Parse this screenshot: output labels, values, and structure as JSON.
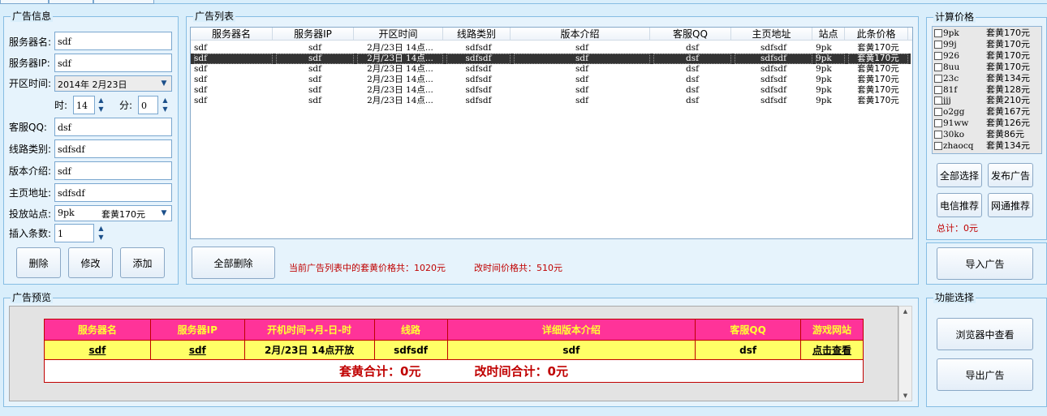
{
  "left_panel": {
    "title": "广告信息",
    "fields": {
      "server_name": {
        "label": "服务器名:",
        "value": "sdf"
      },
      "server_ip": {
        "label": "服务器IP:",
        "value": "sdf"
      },
      "open_time": {
        "label": "开区时间:",
        "value": "2014年 2月23日"
      },
      "hour": {
        "label": "时:",
        "value": "14"
      },
      "minute": {
        "label": "分:",
        "value": "0"
      },
      "qq": {
        "label": "客服QQ:",
        "value": "dsf"
      },
      "line_type": {
        "label": "线路类别:",
        "value": "sdfsdf"
      },
      "version": {
        "label": "版本介绍:",
        "value": "sdf"
      },
      "homepage": {
        "label": "主页地址:",
        "value": "sdfsdf"
      },
      "site": {
        "label": "投放站点:",
        "value_name": "9pk",
        "value_price": "套黄170元"
      },
      "count": {
        "label": "插入条数:",
        "value": "1"
      }
    },
    "buttons": {
      "delete": "删除",
      "modify": "修改",
      "add": "添加"
    }
  },
  "ad_list": {
    "title": "广告列表",
    "columns": [
      "服务器名",
      "服务器IP",
      "开区时间",
      "线路类别",
      "版本介绍",
      "客服QQ",
      "主页地址",
      "站点",
      "此条价格"
    ],
    "rows": [
      [
        "sdf",
        "sdf",
        "2月/23日 14点...",
        "sdfsdf",
        "sdf",
        "dsf",
        "sdfsdf",
        "9pk",
        "套黄170元"
      ],
      [
        "sdf",
        "sdf",
        "2月/23日 14点...",
        "sdfsdf",
        "sdf",
        "dsf",
        "sdfsdf",
        "9pk",
        "套黄170元"
      ],
      [
        "sdf",
        "sdf",
        "2月/23日 14点...",
        "sdfsdf",
        "sdf",
        "dsf",
        "sdfsdf",
        "9pk",
        "套黄170元"
      ],
      [
        "sdf",
        "sdf",
        "2月/23日 14点...",
        "sdfsdf",
        "sdf",
        "dsf",
        "sdfsdf",
        "9pk",
        "套黄170元"
      ],
      [
        "sdf",
        "sdf",
        "2月/23日 14点...",
        "sdfsdf",
        "sdf",
        "dsf",
        "sdfsdf",
        "9pk",
        "套黄170元"
      ],
      [
        "sdf",
        "sdf",
        "2月/23日 14点...",
        "sdfsdf",
        "sdf",
        "dsf",
        "sdfsdf",
        "9pk",
        "套黄170元"
      ]
    ],
    "selected_row": 1,
    "delete_all": "全部删除",
    "summary_yellow": "当前广告列表中的套黄价格共：1020元",
    "summary_time": "改时间价格共：510元"
  },
  "price_calc": {
    "title": "计算价格",
    "items": [
      {
        "name": "9pk",
        "price": "套黄170元"
      },
      {
        "name": "99j",
        "price": "套黄170元"
      },
      {
        "name": "926",
        "price": "套黄170元"
      },
      {
        "name": "8uu",
        "price": "套黄170元"
      },
      {
        "name": "23c",
        "price": "套黄134元"
      },
      {
        "name": "81f",
        "price": "套黄128元"
      },
      {
        "name": "jjj",
        "price": "套黄210元"
      },
      {
        "name": "o2gg",
        "price": "套黄167元"
      },
      {
        "name": "91ww",
        "price": "套黄126元"
      },
      {
        "name": "30ko",
        "price": "套黄86元"
      },
      {
        "name": "zhaocq",
        "price": "套黄134元"
      }
    ],
    "buttons": {
      "select_all": "全部选择",
      "publish": "发布广告",
      "telecom": "电信推荐",
      "netcom": "网通推荐"
    },
    "total": "总计：0元",
    "import": "导入广告"
  },
  "preview": {
    "title": "广告预览",
    "headers": [
      "服务器名",
      "服务器IP",
      "开机时间→月-日-时",
      "线路",
      "详细版本介绍",
      "客服QQ",
      "游戏网站"
    ],
    "row": [
      "sdf",
      "sdf",
      "2月/23日 14点开放",
      "sdfsdf",
      "sdf",
      "dsf",
      "点击查看"
    ],
    "total_yellow": "套黄合计：0元",
    "total_time": "改时间合计：0元",
    "colors": {
      "header_bg": "#ff3399",
      "header_text": "#ffff33",
      "row_bg": "#ffff66",
      "border": "#c00000",
      "total_text": "#c00000"
    }
  },
  "functions": {
    "title": "功能选择",
    "browser": "浏览器中查看",
    "export": "导出广告"
  }
}
